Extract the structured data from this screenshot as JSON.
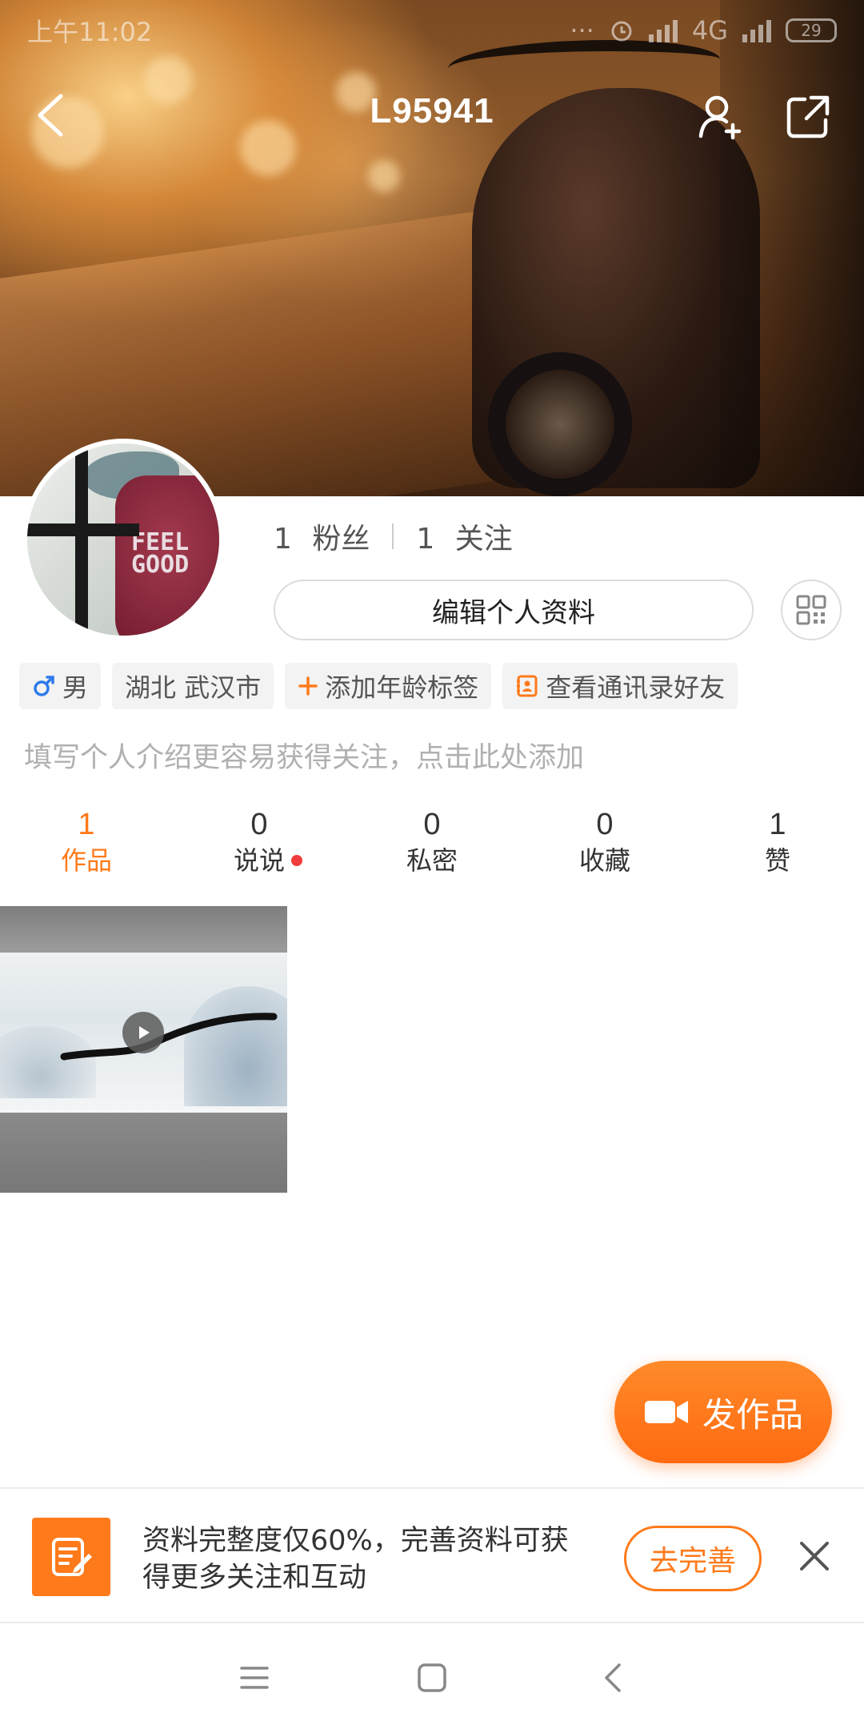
{
  "status_bar": {
    "time": "上午11:02",
    "network": "4G",
    "battery": "29"
  },
  "header": {
    "title": "L95941"
  },
  "profile": {
    "followers_count": "1",
    "followers_label": "粉丝",
    "following_count": "1",
    "following_label": "关注",
    "edit_label": "编辑个人资料",
    "tags": [
      {
        "icon": "male-icon",
        "label": "男"
      },
      {
        "icon": "",
        "label": "湖北 武汉市"
      },
      {
        "icon": "plus-icon",
        "label": "添加年龄标签"
      },
      {
        "icon": "contacts-icon",
        "label": "查看通讯录好友"
      }
    ],
    "bio_placeholder": "填写个人介绍更容易获得关注，点击此处添加"
  },
  "tabs": [
    {
      "count": "1",
      "label": "作品",
      "active": true
    },
    {
      "count": "0",
      "label": "说说",
      "dot": true
    },
    {
      "count": "0",
      "label": "私密"
    },
    {
      "count": "0",
      "label": "收藏"
    },
    {
      "count": "1",
      "label": "赞"
    }
  ],
  "fab": {
    "label": "发作品"
  },
  "banner": {
    "text": "资料完整度仅60%，完善资料可获得更多关注和互动",
    "action_label": "去完善"
  },
  "colors": {
    "accent": "#ff7a1a",
    "dot": "#f03c3c",
    "male": "#2f7bea"
  }
}
